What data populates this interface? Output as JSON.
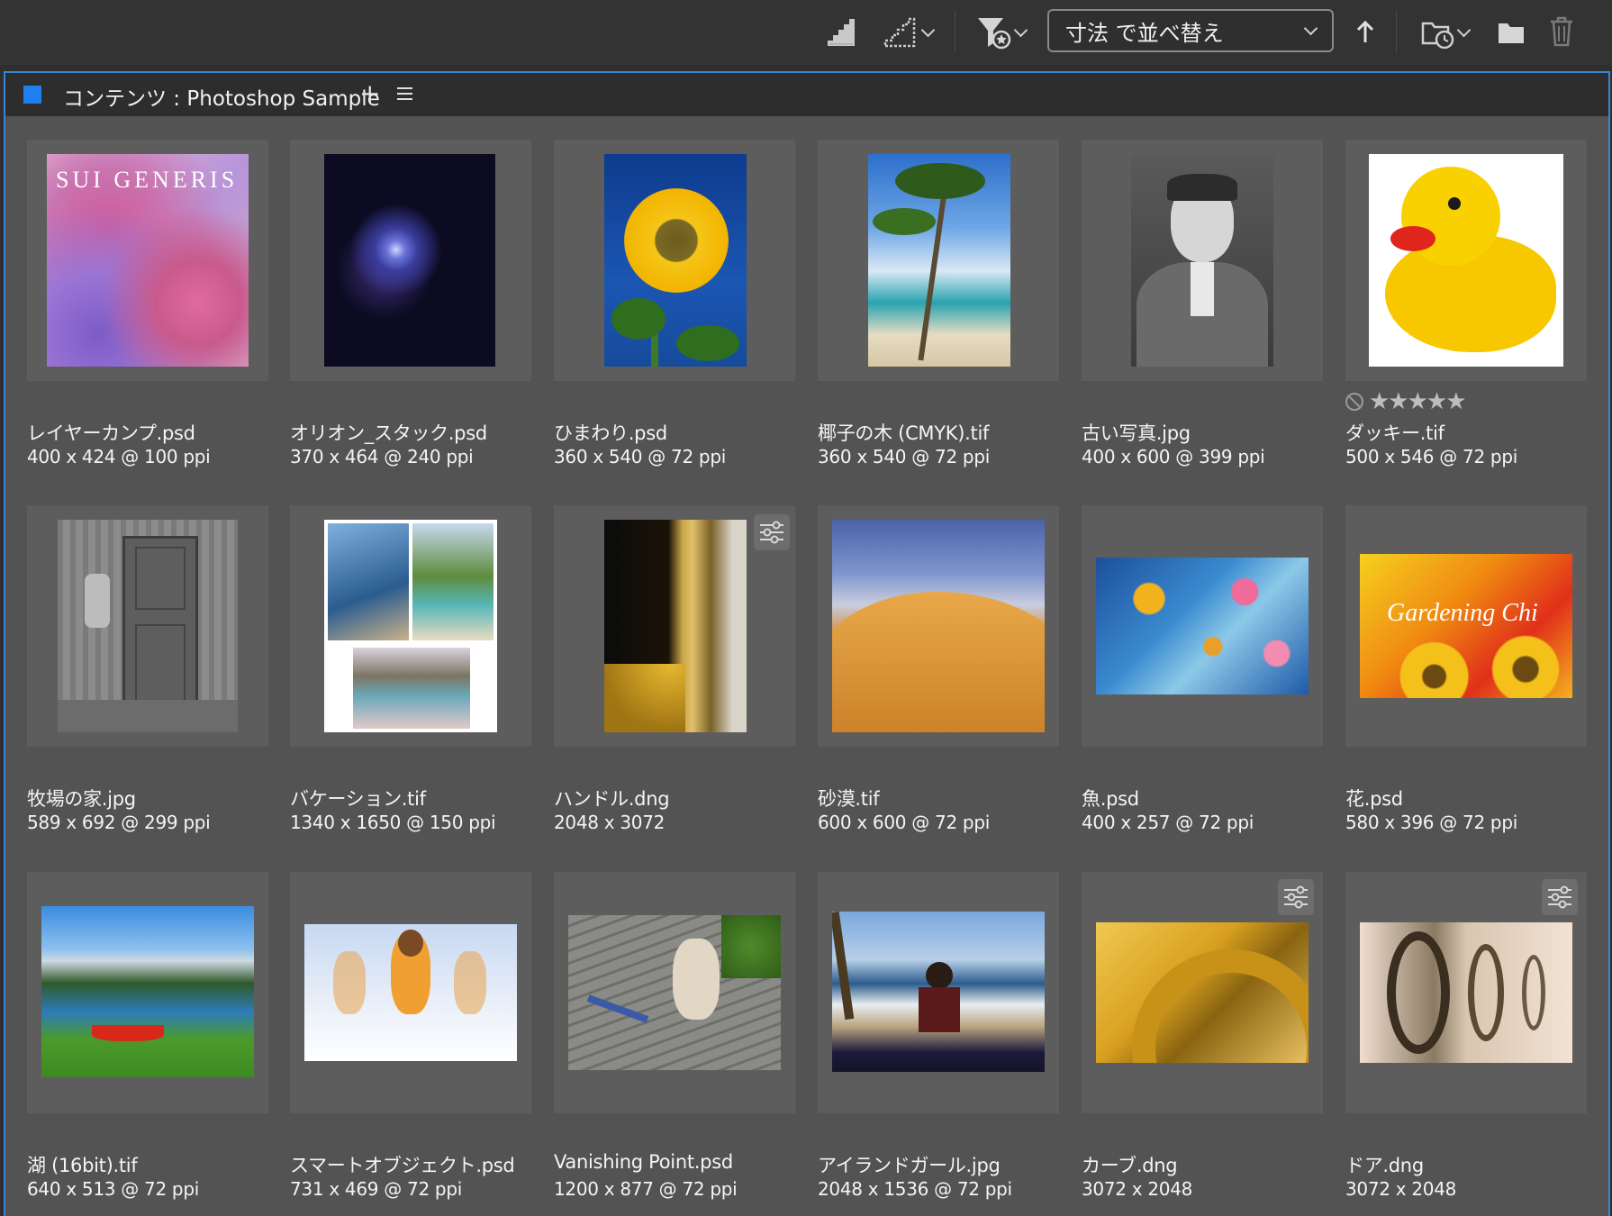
{
  "toolbar": {
    "sort_label": "寸法 で並べ替え",
    "icons": [
      "quality-stairs-icon",
      "quality-stairs-dropdown-icon",
      "filter-star-icon",
      "sort-ascending-arrow-icon",
      "recent-folder-icon",
      "new-folder-icon",
      "trash-icon"
    ]
  },
  "panel": {
    "title": "コンテンツ : Photoshop Sample",
    "add_label": "+",
    "accent": "#1e7ff0"
  },
  "items": [
    {
      "name": "レイヤーカンプ.psd",
      "meta": "400 x 424 @ 100 ppi",
      "thumb_text": "SUI GENERIS"
    },
    {
      "name": "オリオン_スタック.psd",
      "meta": "370 x 464 @ 240 ppi"
    },
    {
      "name": "ひまわり.psd",
      "meta": "360 x 540 @ 72 ppi"
    },
    {
      "name": "椰子の木 (CMYK).tif",
      "meta": "360 x 540 @ 72 ppi"
    },
    {
      "name": "古い写真.jpg",
      "meta": "400 x 600 @ 399 ppi"
    },
    {
      "name": "ダッキー.tif",
      "meta": "500 x 546 @ 72 ppi",
      "rating": "★★★★★"
    },
    {
      "name": "牧場の家.jpg",
      "meta": "589 x 692 @ 299 ppi"
    },
    {
      "name": "バケーション.tif",
      "meta": "1340 x 1650 @ 150 ppi"
    },
    {
      "name": "ハンドル.dng",
      "meta": "2048 x 3072"
    },
    {
      "name": "砂漠.tif",
      "meta": "600 x 600 @ 72 ppi"
    },
    {
      "name": "魚.psd",
      "meta": "400 x 257 @ 72 ppi"
    },
    {
      "name": "花.psd",
      "meta": "580 x 396 @ 72 ppi",
      "thumb_text": "Gardening Chi"
    },
    {
      "name": "湖 (16bit).tif",
      "meta": "640 x 513 @ 72 ppi"
    },
    {
      "name": "スマートオブジェクト.psd",
      "meta": "731 x 469 @ 72 ppi"
    },
    {
      "name": "Vanishing Point.psd",
      "meta": "1200 x 877 @ 72 ppi"
    },
    {
      "name": "アイランドガール.jpg",
      "meta": "2048 x 1536 @ 72 ppi"
    },
    {
      "name": "カーブ.dng",
      "meta": "3072 x 2048"
    },
    {
      "name": "ドア.dng",
      "meta": "3072 x 2048"
    }
  ]
}
